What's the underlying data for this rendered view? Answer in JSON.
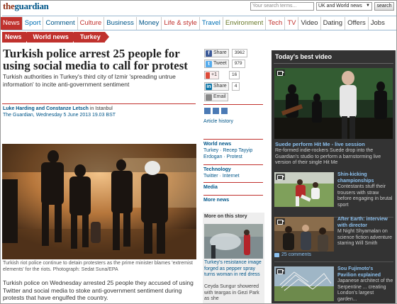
{
  "header": {
    "logo_the": "the",
    "logo_name": "guardian",
    "search_placeholder": "Your search terms...",
    "search_scope": "UK and World news",
    "search_button": "search"
  },
  "nav": {
    "items": [
      {
        "label": "News",
        "active": true
      },
      {
        "label": "Sport"
      },
      {
        "label": "Comment"
      },
      {
        "label": "Culture"
      },
      {
        "label": "Business"
      },
      {
        "label": "Money"
      },
      {
        "label": "Life & style"
      },
      {
        "label": "Travel"
      },
      {
        "label": "Environment"
      },
      {
        "label": "Tech"
      },
      {
        "label": "TV"
      },
      {
        "label": "Video"
      },
      {
        "label": "Dating"
      },
      {
        "label": "Offers"
      },
      {
        "label": "Jobs"
      }
    ]
  },
  "breadcrumbs": [
    "News",
    "World news",
    "Turkey"
  ],
  "article": {
    "headline": "Turkish police arrest 25 people for using social media to call for protest",
    "standfirst": "Turkish authorities in Turkey's third city of Izmir 'spreading untrue information' to incite anti-government sentiment",
    "authors": "Luke Harding and Constanze Letsch",
    "location": " in Istanbul",
    "date": "The Guardian, Wednesday 5 June 2013 19.03 BST",
    "caption": "Turkish riot police continue to detain protesters as the prime minister blames 'extremist elements' for the riots. Photograph: Sedat Suna/EPA",
    "body": "Turkish police on Wednesday arrested 25 people they accused of using Twitter and social media to stoke anti-government sentiment during protests that have engulfed the country."
  },
  "share": {
    "facebook_label": "Share",
    "facebook_count": "3962",
    "twitter_label": "Tweet",
    "twitter_count": "979",
    "gplus_label": "+1",
    "gplus_count": "16",
    "linkedin_label": "Share",
    "linkedin_count": "4",
    "email_label": "Email",
    "article_history": "Article history"
  },
  "related": [
    {
      "head": "World news",
      "links": "Turkey · Recep Tayyip Erdogan · Protest"
    },
    {
      "head": "Technology",
      "links": "Twitter · Internet"
    },
    {
      "head": "Media",
      "links": ""
    },
    {
      "head": "More news",
      "links": ""
    }
  ],
  "more_on_story": {
    "title": "More on this story",
    "headline": "Turkey's resistance image forged as pepper spray turns woman in red dress",
    "body": "Ceyda Sungur showered with teargas in Gezi Park as she"
  },
  "video": {
    "title": "Today's best video",
    "main_headline": "Suede perform Hit Me - live session",
    "main_desc": "Re-formed indie-rockers Suede drop into the Guardian's studio to perform a barnstorming live version of their single Hit Me",
    "items": [
      {
        "headline": "Shin-kicking championships",
        "desc": "Contestants stuff their trousers with straw before engaging in brutal sport"
      },
      {
        "headline": "After Earth: interview with director",
        "desc": "M Night Shyamalan on science fiction adventure starring Will Smith",
        "comments": "25 comments"
      },
      {
        "headline": "Sou Fujimoto's Pavilion explained",
        "desc": "Japanese architect of the Serpentine ... creating London's largest garden..."
      }
    ]
  },
  "colors": {
    "accent_red": "#c0312d",
    "link_blue": "#005689",
    "video_bg": "#333333"
  }
}
